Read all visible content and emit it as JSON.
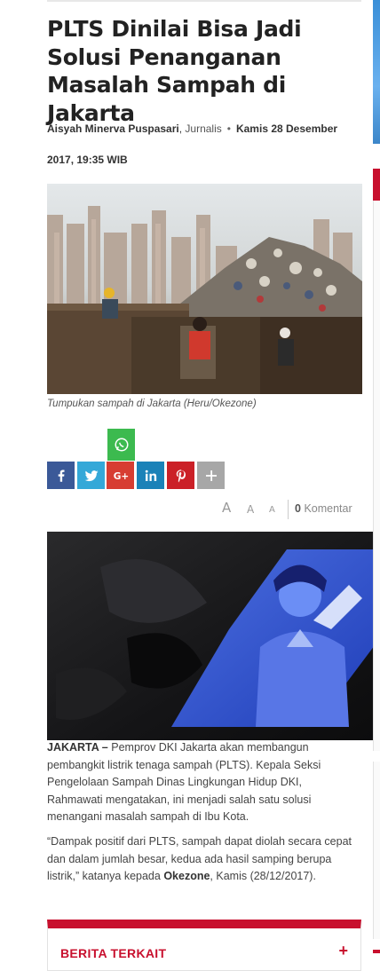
{
  "article": {
    "title": "PLTS Dinilai Bisa Jadi Solusi Penanganan Masalah Sampah di Jakarta",
    "author": "Aisyah Minerva Puspasari",
    "author_role": "Jurnalis",
    "date_part1": "Kamis 28 Desember",
    "date_part2": "2017, 19:35 WIB",
    "photo_caption": "Tumpukan sampah di Jakarta (Heru/Okezone)",
    "paragraph1_dateline": "JAKARTA –",
    "paragraph1_body": " Pemprov DKI Jakarta akan membangun pembangkit listrik tenaga sampah (PLTS). Kepala Seksi Pengelolaan Sampah Dinas Lingkungan Hidup DKI, Rahmawati mengatakan, ini menjadi salah satu solusi menangani masalah sampah di Ibu Kota.",
    "paragraph2_start": "“Dampak positif dari PLTS, sampah dapat diolah secara cepat dan dalam jumlah besar, kedua ada hasil samping berupa listrik,” katanya kepada ",
    "paragraph2_source": "Okezone",
    "paragraph2_end": ", Kamis (28/12/2017)."
  },
  "share": {
    "buttons": [
      {
        "name": "whatsapp",
        "color": "#3cba4f"
      },
      {
        "name": "facebook",
        "color": "#3b5998"
      },
      {
        "name": "twitter",
        "color": "#34a8d8"
      },
      {
        "name": "google-plus",
        "color": "#d73d32"
      },
      {
        "name": "linkedin",
        "color": "#1b82b8"
      },
      {
        "name": "pinterest",
        "color": "#cb2027"
      },
      {
        "name": "more",
        "color": "#a7a7a7"
      }
    ]
  },
  "tools": {
    "font_large": "A",
    "font_medium": "A",
    "font_small": "A",
    "comment_count": "0",
    "comment_label": "Komentar"
  },
  "related": {
    "title": "BERITA TERKAIT",
    "toggle": "+"
  },
  "colors": {
    "accent": "#c8102e",
    "text": "#333333"
  }
}
